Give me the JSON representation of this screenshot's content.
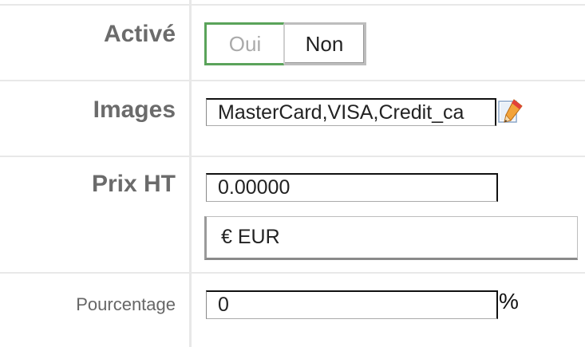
{
  "rows": {
    "active": {
      "label": "Activé",
      "yes": "Oui",
      "no": "Non"
    },
    "images": {
      "label": "Images",
      "value": "MasterCard,VISA,Credit_ca"
    },
    "price": {
      "label": "Prix HT",
      "value": "0.00000",
      "currency": "€ EUR"
    },
    "percentage": {
      "label": "Pourcentage",
      "value": "0",
      "unit": "%"
    }
  },
  "icons": {
    "edit": "pencil-edit-icon"
  },
  "colors": {
    "active_border": "#5aa35a",
    "label_text": "#6b6b6b",
    "grid": "#e8e8e8"
  }
}
